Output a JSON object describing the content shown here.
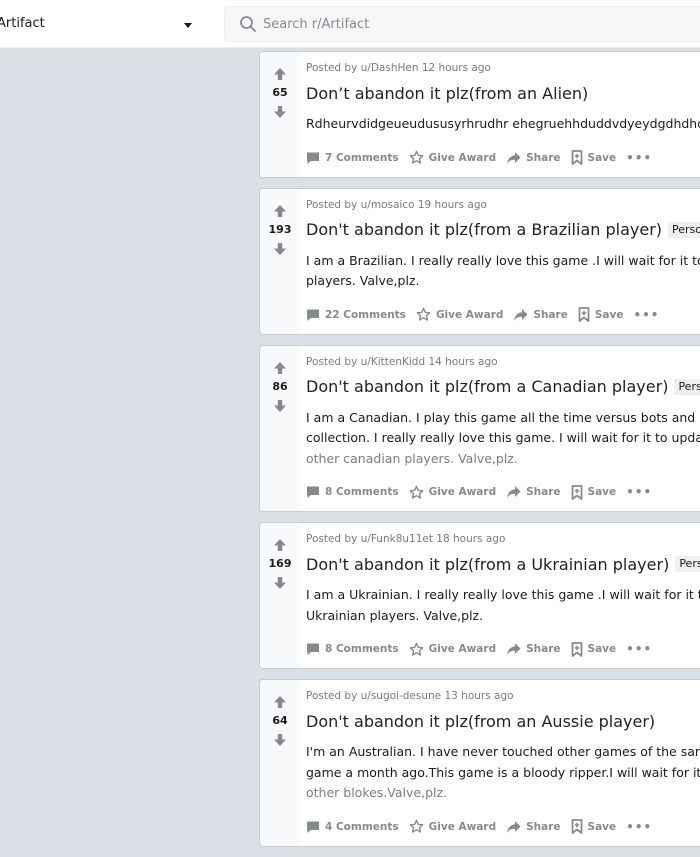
{
  "header": {
    "community": "Artifact",
    "search_placeholder": "Search r/Artifact"
  },
  "posts": [
    {
      "score": "65",
      "meta": "Posted by u/DashHen 12 hours ago",
      "title": "Don’t abandon it plz(from an Alien)",
      "flair": "",
      "body": [
        "Rdheurvdidgeueudususyrhrudhr ehegruehhduddvdyeydgdhdhdhdudu"
      ],
      "faded": "",
      "comments": "7 Comments"
    },
    {
      "score": "193",
      "meta": "Posted by u/mosaico 19 hours ago",
      "title": "Don't abandon it plz(from a Brazilian player)",
      "flair": "Personal",
      "body": [
        "I am a Brazilian. I really really love this game .I will wait for it to update with other",
        "players. Valve,plz."
      ],
      "faded": "",
      "comments": "22 Comments"
    },
    {
      "score": "86",
      "meta": "Posted by u/KittenKidd 14 hours ago",
      "title": "Don't abandon it plz(from a Canadian player)",
      "flair": "Personal",
      "body": [
        "I am a Canadian. I play this game all the time versus bots and building my",
        "collection. I really really love this game. I will wait for it to update with"
      ],
      "faded": "other canadian players. Valve,plz.",
      "comments": "8 Comments"
    },
    {
      "score": "169",
      "meta": "Posted by u/Funk8u11et 18 hours ago",
      "title": "Don't abandon it plz(from a Ukrainian player)",
      "flair": "Personal",
      "body": [
        "I am a Ukrainian. I really really love this game .I will wait for it to update with other",
        "Ukrainian players. Valve,plz."
      ],
      "faded": "",
      "comments": "8 Comments"
    },
    {
      "score": "64",
      "meta": "Posted by u/sugoi-desune 13 hours ago",
      "title": "Don't abandon it plz(from an Aussie player)",
      "flair": "",
      "body": [
        "I'm an Australian. I have never touched other games of the same genre",
        "game a month ago.This game is a bloody ripper.I will wait for it to update with"
      ],
      "faded": "other blokes.Valve,plz.",
      "comments": "4 Comments"
    }
  ],
  "actions": {
    "award": "Give Award",
    "share": "Share",
    "save": "Save",
    "more": "•••"
  },
  "colors": {
    "page_bg": "#dae0e6",
    "vote_gray": "#878a8c",
    "meta_gray": "#787c7e"
  }
}
